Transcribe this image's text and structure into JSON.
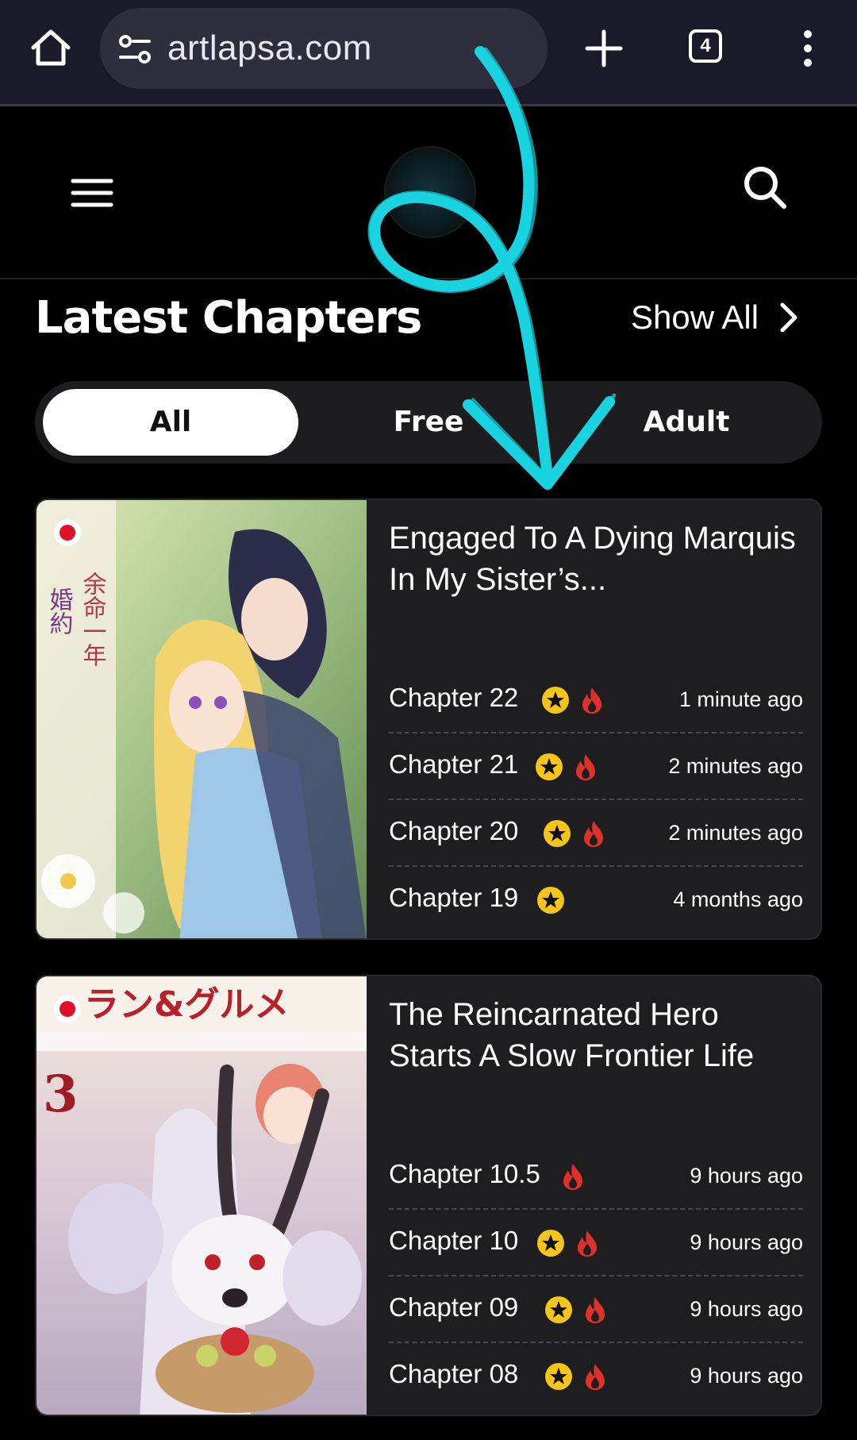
{
  "browser": {
    "url": "artlapsa.com",
    "tab_count": "4",
    "icons": {
      "home": "home-icon",
      "site_info": "site-settings-icon",
      "new_tab": "plus-icon",
      "more": "more-vertical-icon"
    }
  },
  "header": {
    "icons": {
      "menu": "hamburger-menu-icon",
      "logo": "site-logo",
      "search": "search-icon"
    }
  },
  "section": {
    "title": "Latest Chapters",
    "show_all_label": "Show All"
  },
  "filters": [
    {
      "label": "All",
      "active": true
    },
    {
      "label": "Free",
      "active": false
    },
    {
      "label": "Adult",
      "active": false
    }
  ],
  "cards": [
    {
      "title": "Engaged To A Dying Marquis In My Sister’s...",
      "chapters": [
        {
          "name": "Chapter 22",
          "time": "1 minute ago",
          "star": true,
          "fire": true
        },
        {
          "name": "Chapter 21",
          "time": "2 minutes ago",
          "star": true,
          "fire": true
        },
        {
          "name": "Chapter 20",
          "time": "2 minutes ago",
          "star": true,
          "fire": true
        },
        {
          "name": "Chapter 19",
          "time": "4 months ago",
          "star": true,
          "fire": false
        }
      ]
    },
    {
      "title": "The Reincarnated Hero Starts A Slow Frontier Life",
      "chapters": [
        {
          "name": "Chapter 10.5",
          "time": "9 hours ago",
          "star": false,
          "fire": true
        },
        {
          "name": "Chapter 10",
          "time": "9 hours ago",
          "star": true,
          "fire": true
        },
        {
          "name": "Chapter 09",
          "time": "9 hours ago",
          "star": true,
          "fire": true
        },
        {
          "name": "Chapter 08",
          "time": "9 hours ago",
          "star": true,
          "fire": true
        }
      ]
    }
  ],
  "colors": {
    "star": "#f5c518",
    "fire": "#e0302a",
    "overlay_arrow": "#19d3e0"
  }
}
